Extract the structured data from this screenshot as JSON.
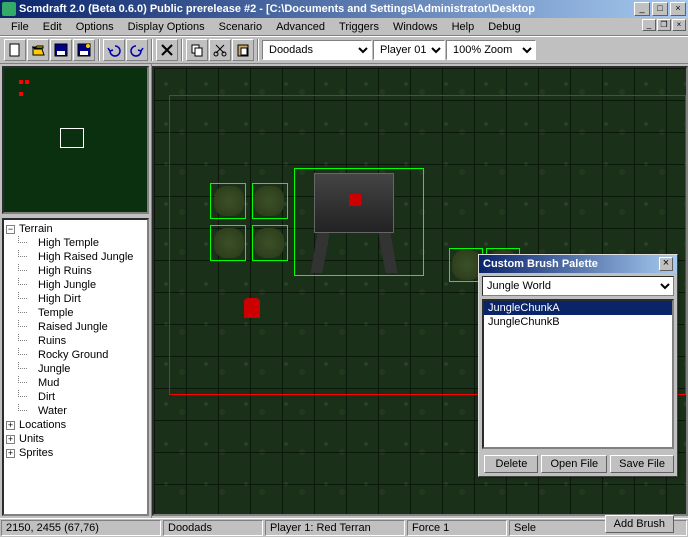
{
  "title": "Scmdraft 2.0 (Beta 0.6.0)  Public prerelease #2 - [C:\\Documents and Settings\\Administrator\\Desktop",
  "menu": [
    "File",
    "Edit",
    "Options",
    "Display Options",
    "Scenario",
    "Advanced",
    "Triggers",
    "Windows",
    "Help",
    "Debug"
  ],
  "toolbar": {
    "layer_select": "Doodads",
    "player_select": "Player 01",
    "zoom_select": "100% Zoom"
  },
  "tree": {
    "root": "Terrain",
    "children": [
      "High Temple",
      "High Raised Jungle",
      "High Ruins",
      "High Jungle",
      "High Dirt",
      "Temple",
      "Raised Jungle",
      "Ruins",
      "Rocky Ground",
      "Jungle",
      "Mud",
      "Dirt",
      "Water"
    ],
    "roots2": [
      "Locations",
      "Units",
      "Sprites"
    ]
  },
  "palette": {
    "title": "Custom Brush Palette",
    "tileset": "Jungle World",
    "items": [
      "JungleChunkA",
      "JungleChunkB"
    ],
    "selected": 0,
    "btn_delete": "Delete",
    "btn_open": "Open File",
    "btn_save": "Save File",
    "btn_add": "Add Brush"
  },
  "status": {
    "coords": "2150, 2455 (67,76)",
    "layer": "Doodads",
    "player": "Player 1: Red Terran",
    "force": "Force 1",
    "sel": "Sele"
  }
}
